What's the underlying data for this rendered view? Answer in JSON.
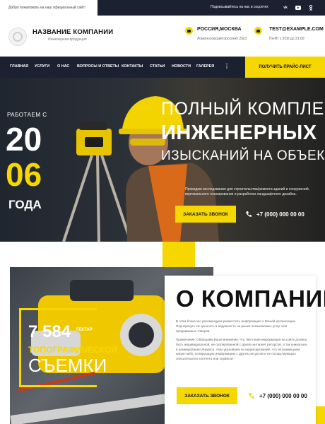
{
  "topbar": {
    "welcome": "Добро пожаловать на наш официальный сайт!",
    "subscribe": "Подписывайтесь на нас в соцсетях",
    "socials": [
      "vk-icon",
      "youtube-icon",
      "odnoklassniki-icon"
    ]
  },
  "header": {
    "company_name": "НАЗВАНИЕ КОМПАНИИ",
    "company_sub": "Инженерная продукция",
    "city": "РОССИЯ,МОСКВА",
    "address": "Ломоносовский проспект 25к3",
    "email": "TEST@EXAMPLE.COM",
    "hours": "Пн-Вт с 9:00 до 21:00"
  },
  "nav": {
    "items": [
      "ГЛАВНАЯ",
      "УСЛУГИ",
      "О НАС",
      "ВОПРОСЫ И ОТВЕТЫ",
      "КОНТАКТЫ",
      "СТАТЬИ",
      "НОВОСТИ",
      "ГАЛЕРЕЯ"
    ],
    "more": "⋮",
    "price_button": "ПОЛУЧИТЬ ПРАЙС-ЛИСТ"
  },
  "hero": {
    "since_label": "РАБОТАЕМ С",
    "since_num1": "20",
    "since_num2": "06",
    "since_year": "ГОДА",
    "headline_1": "ПОЛНЫЙ КОМПЛЕКС",
    "headline_2": "ИНЖЕНЕРНЫХ",
    "headline_3": "ИЗЫСКАНИЙ НА ОБЪЕКТЕ",
    "description": "Проведем исследования для строительства/ремонта зданий и сооружений, вертикального планирования и разработки ландшафтного дизайна.",
    "call_button": "ЗАКАЗАТЬ ЗВОНОК",
    "phone": "+7 (000) 000 00 00"
  },
  "about": {
    "title": "О КОМПАНИИ",
    "para1": "В этом блоке мы рекомендуем разместить информацию о Вашей организации. Подчеркнуть её ценность и надежность на рынке оказываемых услуг или продаваемых товаров.",
    "para2": "Примечание: Обращаем Ваше внимание, что текстовая информация на сайте должна быть индивидуальной, не скопированной с других интернет ресурсов, а так уникальна в ранжировании Яндекса. «Мы указываем на индексирование, что не размещаем какую-либо, копирующую информацию с других ресурсов и не соседствующую описательного контента или сервиса».",
    "stat_number": "7 584",
    "stat_unit": "ГЕКТАР",
    "stat_line1": "ТОПОГРАФИЧЕСКОЙ",
    "stat_line2": "СЪЕМКИ",
    "call_button": "ЗАКАЗАТЬ ЗВОНОК",
    "phone": "+7 (000) 000 00 00"
  },
  "colors": {
    "accent": "#f6d800",
    "dark": "#1c2131"
  }
}
